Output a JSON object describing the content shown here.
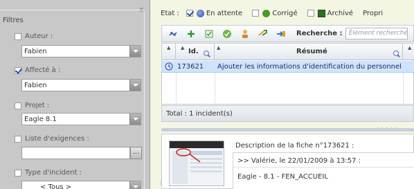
{
  "filters": {
    "legend": "Filtres",
    "close_glyph": "x",
    "items": [
      {
        "label": "Auteur :",
        "checked": false,
        "value": "Fabien"
      },
      {
        "label": "Affecté à :",
        "checked": true,
        "value": "Fabien"
      },
      {
        "label": "Projet :",
        "checked": false,
        "value": "Eagle 8.1"
      },
      {
        "label": "Liste d'exigences :",
        "checked": false,
        "value": "",
        "button": "..."
      },
      {
        "label": "Type d'incident :",
        "checked": false,
        "value": "< Tous >"
      }
    ]
  },
  "etat": {
    "label": "Etat :",
    "options": [
      {
        "label": "En attente",
        "checked": true,
        "icon": "pending-circle-icon"
      },
      {
        "label": "Corrigé",
        "checked": false,
        "icon": "corrected-check-icon"
      },
      {
        "label": "Archivé",
        "checked": false,
        "icon": "archive-book-icon"
      }
    ],
    "trailing": "Propri"
  },
  "toolbar": {
    "buttons": [
      "refresh-icon",
      "add-icon",
      "edit-sheet-icon",
      "validate-icon",
      "assign-user-icon",
      "forward-icon",
      "transfer-icon"
    ],
    "search_label": "Recherche :",
    "search_placeholder": "Élément recherché"
  },
  "grid": {
    "columns": {
      "id": "Id.",
      "summary": "Résumé"
    },
    "rows": [
      {
        "id": "173621",
        "summary": "Ajouter les informations d'identification du personnel"
      }
    ],
    "total": "Total : 1 incident(s)"
  },
  "detail": {
    "title": "Description de la fiche n°173621 :",
    "lines": [
      ">> Valérie, le 22/01/2009 à 13:57 :",
      "Eagle - 8.1 - FEN_ACCUEIL"
    ]
  },
  "colors": {
    "accent_blue": "#2a45b0",
    "selected_row": "#cfe4fb",
    "panel_gray": "#c8c8c8",
    "page_bg": "#f3f6e3"
  }
}
